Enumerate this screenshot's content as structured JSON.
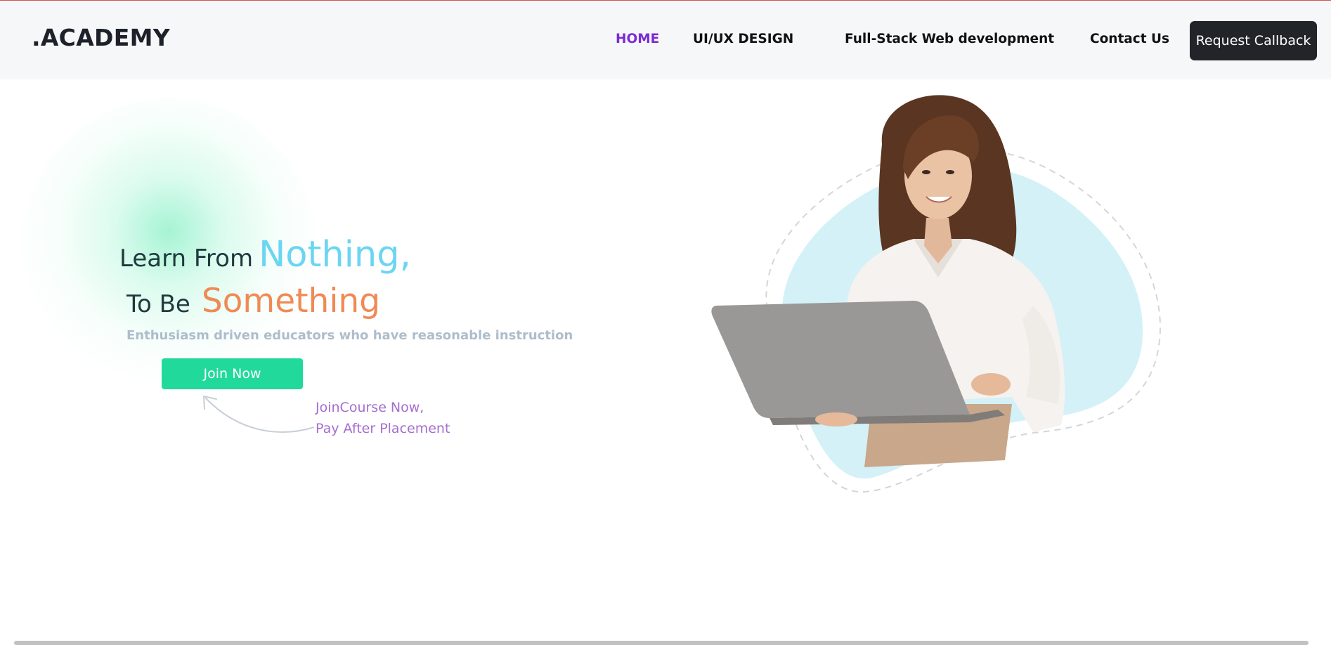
{
  "navbar": {
    "brand": ".ACADEMY",
    "links": [
      {
        "label": "HOME",
        "active": true
      },
      {
        "label": "UI/UX DESIGN",
        "active": false
      },
      {
        "label": "Full-Stack Web development",
        "active": false
      },
      {
        "label": "Contact Us",
        "active": false
      }
    ],
    "cta_label": "Request Callback"
  },
  "hero": {
    "line1_prefix": "Learn From",
    "line1_highlight": "Nothing,",
    "line2_prefix": "To Be",
    "line2_highlight": "Something",
    "tagline": "Enthusiasm driven educators who have reasonable instruction",
    "join_button": "Join Now",
    "note_line1": "JoinCourse Now,",
    "note_line2": "Pay After Placement"
  },
  "colors": {
    "active_link": "#7b2bd3",
    "highlight_blue": "#6bd5f2",
    "highlight_orange": "#f08a55",
    "join_button": "#22d99c",
    "note_text": "#a56fcc",
    "dark_button": "#212529"
  }
}
